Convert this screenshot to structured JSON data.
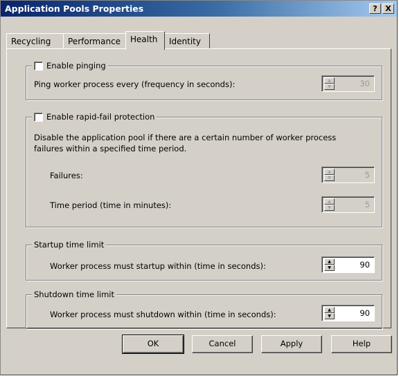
{
  "window": {
    "title": "Application Pools Properties",
    "help_btn": "?",
    "close_btn": "X"
  },
  "tabs": [
    {
      "label": "Recycling"
    },
    {
      "label": "Performance"
    },
    {
      "label": "Health"
    },
    {
      "label": "Identity"
    }
  ],
  "active_tab": "Health",
  "pinging": {
    "checkbox_label": "Enable pinging",
    "checked": false,
    "row_label": "Ping worker process every (frequency in seconds):",
    "value": "30",
    "enabled": false
  },
  "rapid_fail": {
    "checkbox_label": "Enable rapid-fail protection",
    "checked": false,
    "description_line1": "Disable the application pool if there are a certain number of worker process",
    "description_line2": "failures within a specified time period.",
    "failures_label": "Failures:",
    "failures_value": "5",
    "period_label": "Time period (time in minutes):",
    "period_value": "5",
    "enabled": false
  },
  "startup": {
    "group_label": "Startup time limit",
    "row_label": "Worker process must startup within (time in seconds):",
    "value": "90"
  },
  "shutdown": {
    "group_label": "Shutdown time limit",
    "row_label": "Worker process must shutdown within (time in seconds):",
    "value": "90"
  },
  "buttons": {
    "ok": "OK",
    "cancel": "Cancel",
    "apply": "Apply",
    "help": "Help"
  },
  "colors": {
    "title_start": "#0a246a",
    "title_end": "#a6caf0",
    "face": "#d4d0c8"
  }
}
